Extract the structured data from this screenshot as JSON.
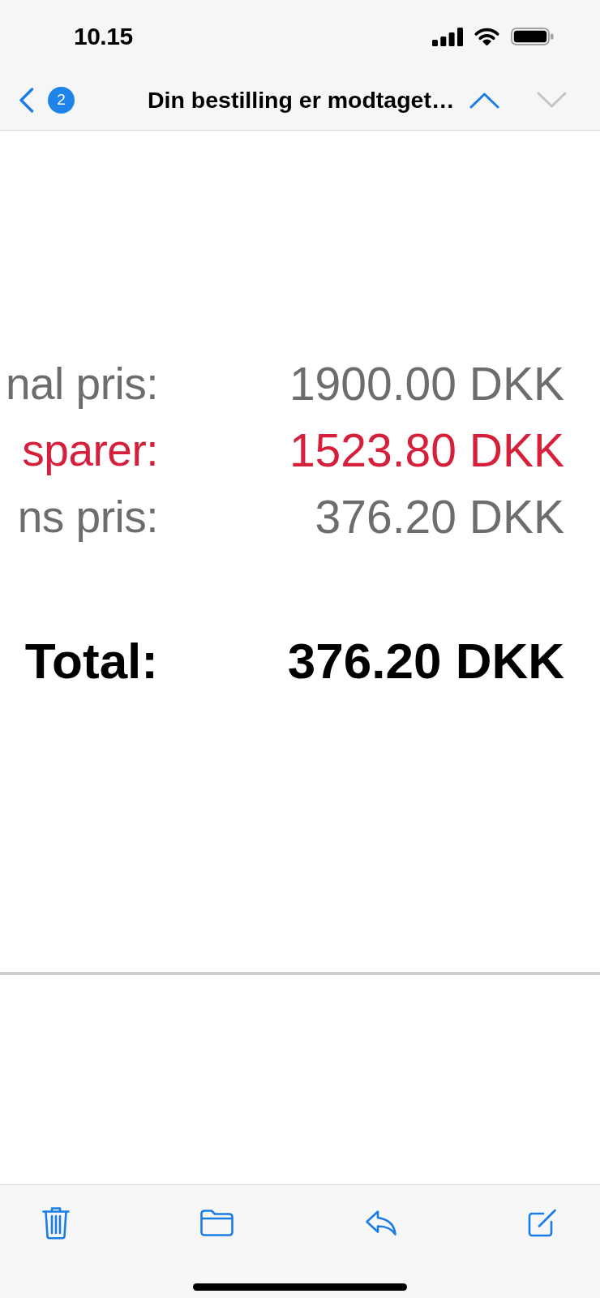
{
  "status_bar": {
    "time": "10.15"
  },
  "nav_bar": {
    "unread_count": "2",
    "title": "Din bestilling er modtaget…",
    "message_arrows": [
      {
        "kind": "previous",
        "disabled": false
      },
      {
        "kind": "next",
        "disabled": true
      }
    ]
  },
  "price_rows": [
    {
      "kind": "normal",
      "label": "nal pris:",
      "value": "1900.00 DKK"
    },
    {
      "kind": "saving",
      "label": "sparer:",
      "value": "1523.80 DKK"
    },
    {
      "kind": "normal",
      "label": "ns pris:",
      "value": "376.20 DKK"
    }
  ],
  "total": {
    "label": "Total:",
    "value": "376.20 DKK"
  }
}
